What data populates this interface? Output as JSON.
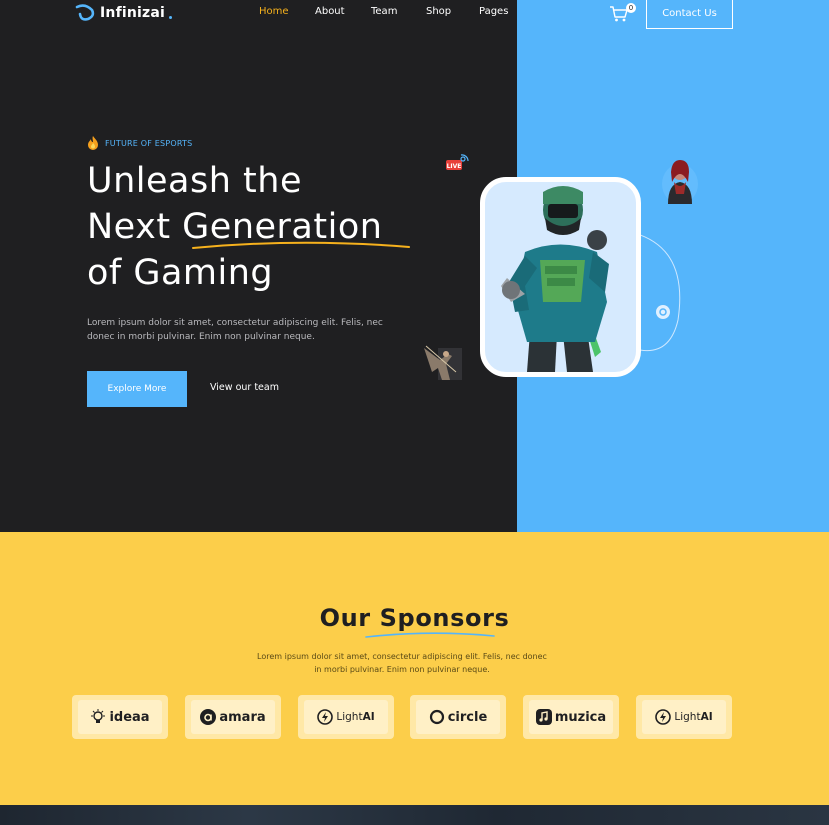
{
  "brand": {
    "name": "Infinizai"
  },
  "nav": {
    "items": [
      {
        "label": "Home",
        "active": true
      },
      {
        "label": "About",
        "active": false
      },
      {
        "label": "Team",
        "active": false
      },
      {
        "label": "Shop",
        "active": false
      },
      {
        "label": "Pages",
        "active": false
      }
    ],
    "cart_count": "0",
    "contact_label": "Contact Us"
  },
  "hero": {
    "eyebrow": "FUTURE OF ESPORTS",
    "headline_line1": "Unleash the",
    "headline_line2": "Next Generation",
    "headline_line3": "of Gaming",
    "description": "Lorem ipsum dolor sit amet, consectetur adipiscing elit. Felis, nec donec in morbi pulvinar. Enim non pulvinar neque.",
    "primary_button": "Explore More",
    "secondary_link": "View our team",
    "live_badge": "LIVE"
  },
  "sponsors": {
    "title": "Our Sponsors",
    "description": "Lorem ipsum dolor sit amet, consectetur adipiscing elit. Felis, nec donec in morbi pulvinar. Enim non pulvinar neque.",
    "logos": [
      {
        "name": "ideaa",
        "icon": "bulb-icon"
      },
      {
        "name": "amara",
        "icon": "a-circle-icon"
      },
      {
        "name_prefix": "Light",
        "name_suffix": "AI",
        "icon": "bolt-icon"
      },
      {
        "name": "circle",
        "icon": "circle-icon"
      },
      {
        "name": "muzica",
        "icon": "music-icon"
      },
      {
        "name_prefix": "Light",
        "name_suffix": "AI",
        "icon": "bolt-icon"
      }
    ]
  },
  "colors": {
    "dark": "#1f1f21",
    "blue": "#55b5fb",
    "yellow": "#fcce4a",
    "accent_orange": "#f6b11d"
  }
}
